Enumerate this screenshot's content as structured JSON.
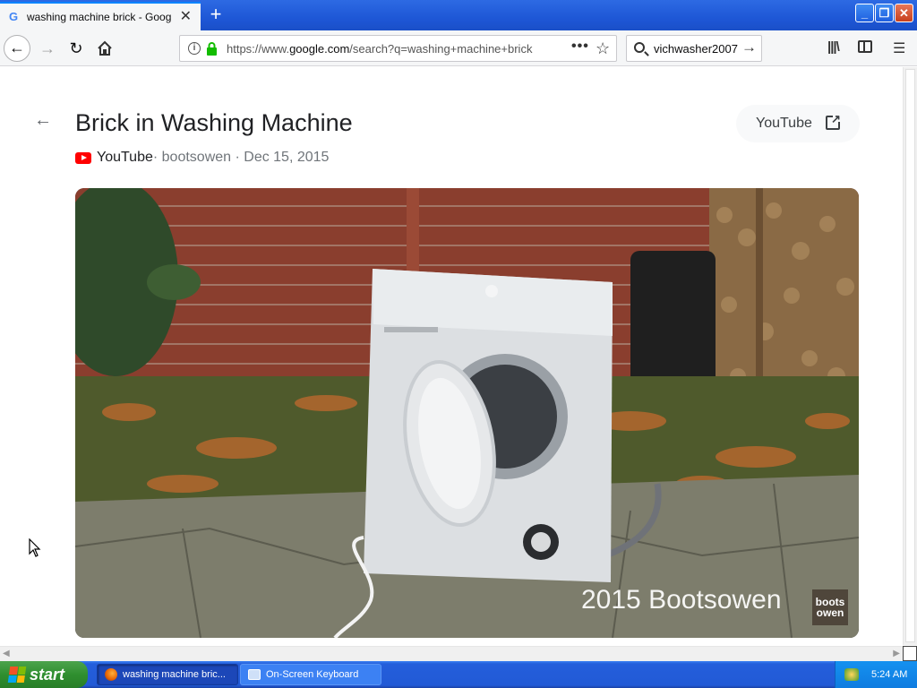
{
  "browser": {
    "tab_title": "washing machine brick - Google Se",
    "tab_favicon": "G",
    "new_tab_label": "+",
    "window_buttons": {
      "minimize": "_",
      "maximize": "❐",
      "close": "✕"
    },
    "url_prefix": "https://www.",
    "url_domain": "google.com",
    "url_path": "/search?q=washing+machine+brick",
    "search_text": "vichwasher2007",
    "page_actions": "•••"
  },
  "result": {
    "title": "Brick in Washing Machine",
    "source": "YouTube",
    "meta_rest": " · bootsowen · Dec 15, 2015",
    "visit_label": "YouTube",
    "watermark_text": "2015 Bootsowen",
    "watermark_logo_line1": "boots",
    "watermark_logo_line2": "owen"
  },
  "taskbar": {
    "start_label": "start",
    "tasks": [
      {
        "label": "washing machine bric..."
      },
      {
        "label": "On-Screen Keyboard"
      }
    ],
    "clock": "5:24 AM"
  },
  "colors": {
    "xp_blue": "#245edb",
    "start_green": "#2f8f2f",
    "youtube_red": "#ff0000",
    "firefox_lock_green": "#12bc00"
  },
  "icons": {
    "back": "arrow-left-icon",
    "forward": "arrow-right-icon",
    "reload": "reload-icon",
    "home": "home-icon",
    "info": "info-icon",
    "lock": "lock-icon",
    "bookmark": "star-icon",
    "search": "search-icon",
    "library": "library-icon",
    "sidebar": "sidebar-icon",
    "menu": "hamburger-icon",
    "external": "external-link-icon"
  }
}
